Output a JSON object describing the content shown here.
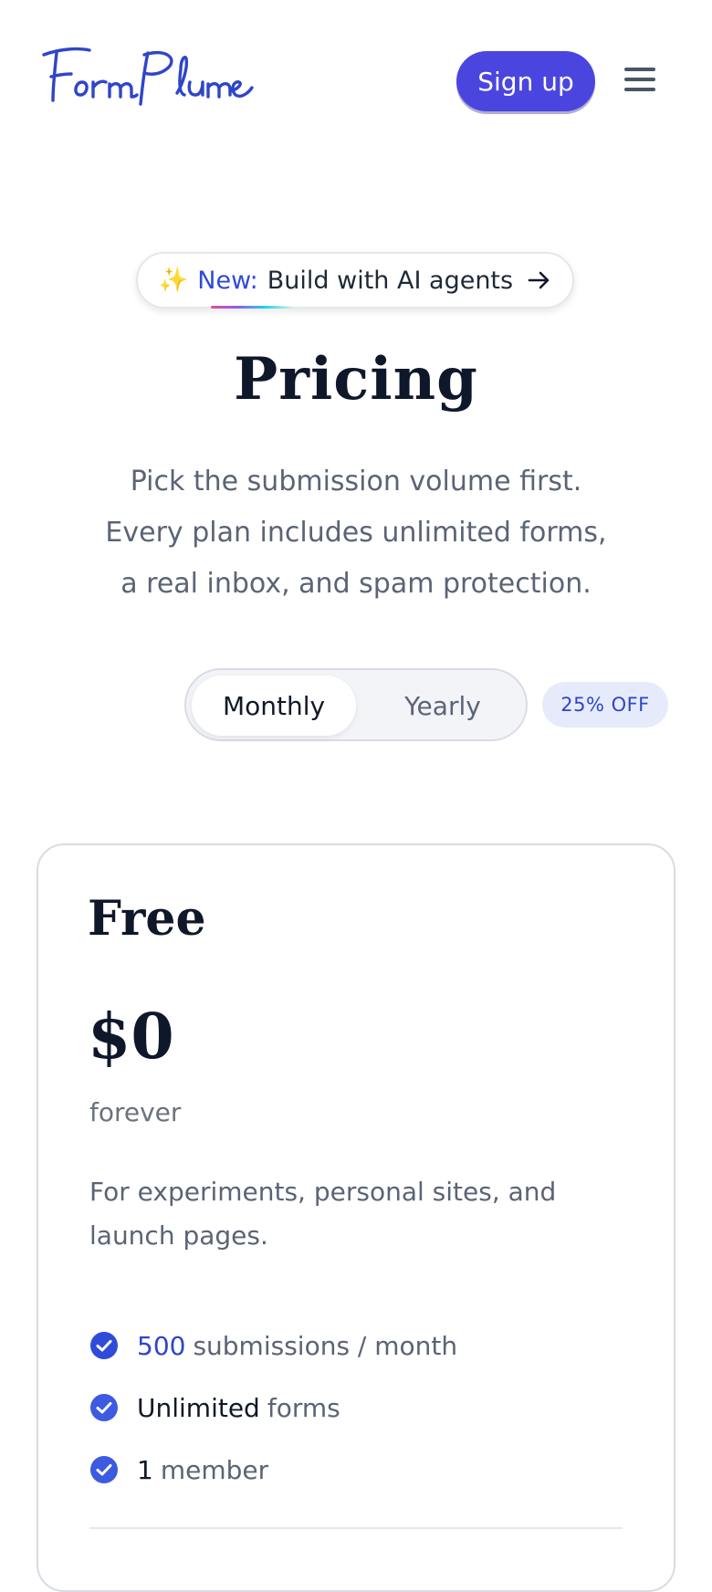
{
  "brand": {
    "logo_text": "Form Plume",
    "color": "#2f45c8"
  },
  "header": {
    "signup_label": "Sign up",
    "menu_icon": "hamburger-menu-icon"
  },
  "announcement": {
    "emoji": "✨",
    "new_label": "New:",
    "text": "Build with AI agents",
    "arrow_icon": "arrow-right-icon"
  },
  "hero": {
    "title": "Pricing",
    "subtitle_lines": [
      "Pick the submission volume first.",
      "Every plan includes unlimited forms,",
      "a real inbox, and spam protection."
    ]
  },
  "billing": {
    "options": [
      "Monthly",
      "Yearly"
    ],
    "selected": "Monthly",
    "discount_badge": "25% OFF"
  },
  "plans": [
    {
      "name": "Free",
      "price": "$0",
      "period": "forever",
      "description": "For experiments, personal sites, and launch pages.",
      "features": [
        {
          "lead": "500",
          "rest": "submissions / month",
          "style": "highlight"
        },
        {
          "lead": "Unlimited",
          "rest": "forms",
          "style": "strong"
        },
        {
          "lead": "1",
          "rest": "member",
          "style": "strong"
        }
      ]
    }
  ],
  "colors": {
    "accent": "#4b45e0",
    "check": "#2f4bd8",
    "muted_text": "#5b6475",
    "badge_bg": "#e6ebfb"
  }
}
